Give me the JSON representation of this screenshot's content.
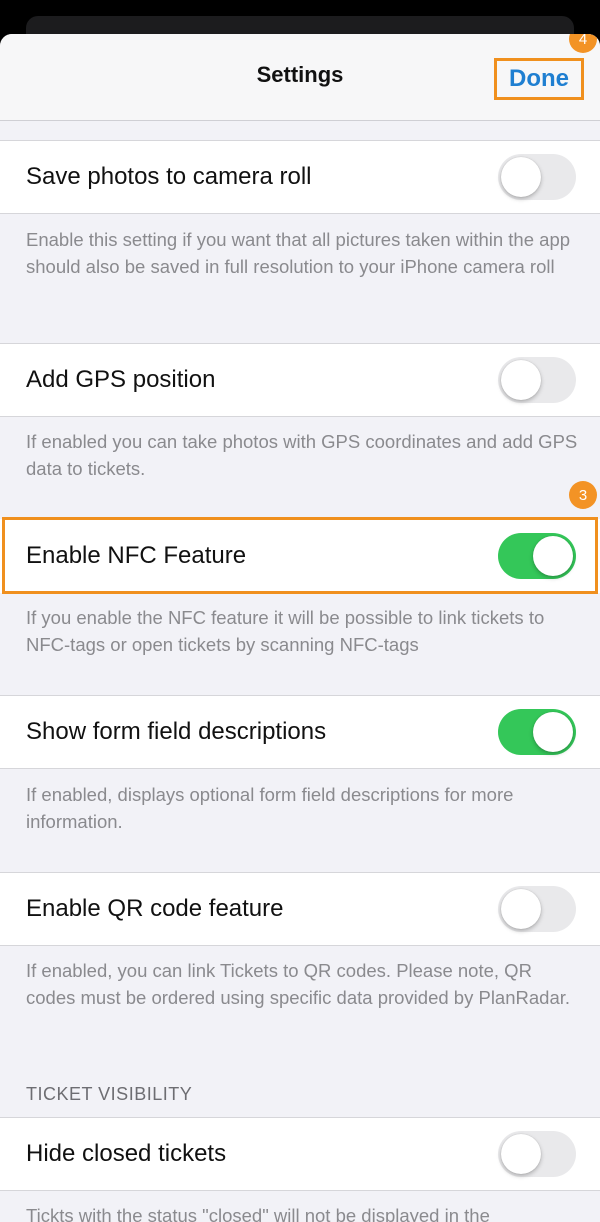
{
  "header": {
    "title": "Settings",
    "done_label": "Done",
    "done_badge": "4"
  },
  "settings": [
    {
      "label": "Save photos to camera roll",
      "enabled": false,
      "description": "Enable this setting if you want that all pictures taken within the app should also be saved in full resolution to your iPhone camera roll"
    },
    {
      "label": "Add GPS position",
      "enabled": false,
      "description": "If enabled you can take photos with GPS coordinates and add GPS data to tickets."
    },
    {
      "label": "Enable NFC Feature",
      "enabled": true,
      "badge": "3",
      "description": "If you enable the NFC feature it will be possible to link tickets to NFC-tags or open tickets by scanning NFC-tags"
    },
    {
      "label": "Show form field descriptions",
      "enabled": true,
      "description": "If enabled, displays optional form field descriptions for more information."
    },
    {
      "label": "Enable QR code feature",
      "enabled": false,
      "description": "If enabled, you can link Tickets to QR codes. Please note, QR codes must be ordered using specific data provided by PlanRadar."
    }
  ],
  "ticket_visibility": {
    "header": "TICKET VISIBILITY",
    "label": "Hide closed tickets",
    "enabled": false,
    "description": "Tickts with the status \"closed\" will not be displayed in the"
  },
  "colors": {
    "accent": "#1f7fd1",
    "highlight": "#f0901e",
    "toggle_on": "#34c759",
    "toggle_off": "#e9e9eb"
  }
}
